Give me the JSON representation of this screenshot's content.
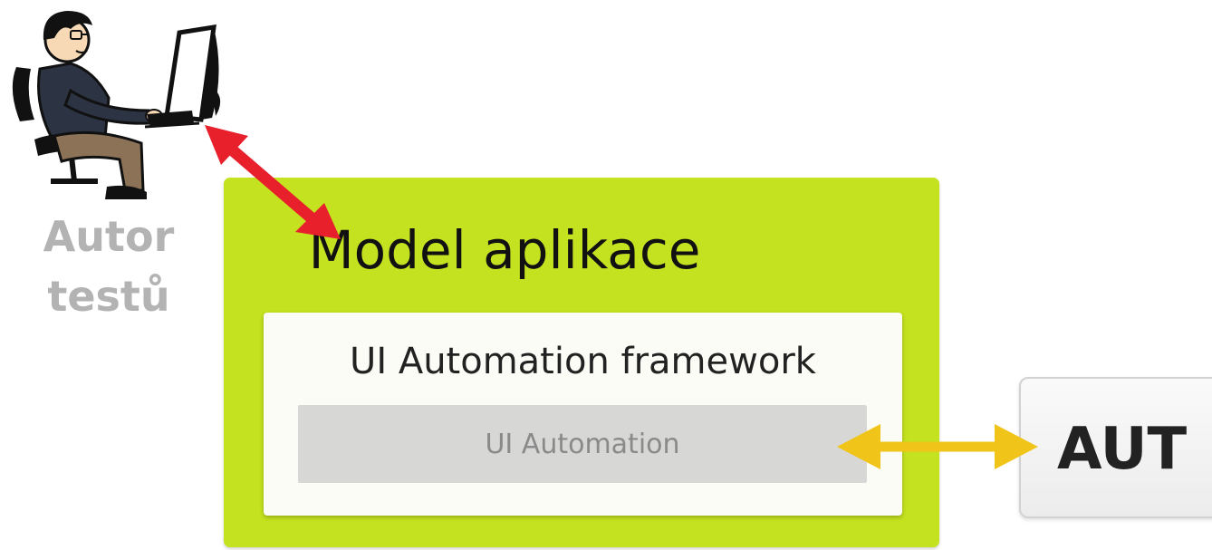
{
  "author": {
    "label_line1": "Autor",
    "label_line2": "testů",
    "icon": "person-at-computer-icon"
  },
  "model_box": {
    "title": "Model aplikace",
    "color": "#c4e21f"
  },
  "framework_box": {
    "title": "UI Automation framework",
    "color": "#fcfcf6"
  },
  "uia_box": {
    "title": "UI Automation",
    "color": "#d7d7d5"
  },
  "aut_box": {
    "title": "AUT"
  },
  "arrows": {
    "author_model_color": "#e8202c",
    "uia_aut_color": "#f0c419"
  }
}
